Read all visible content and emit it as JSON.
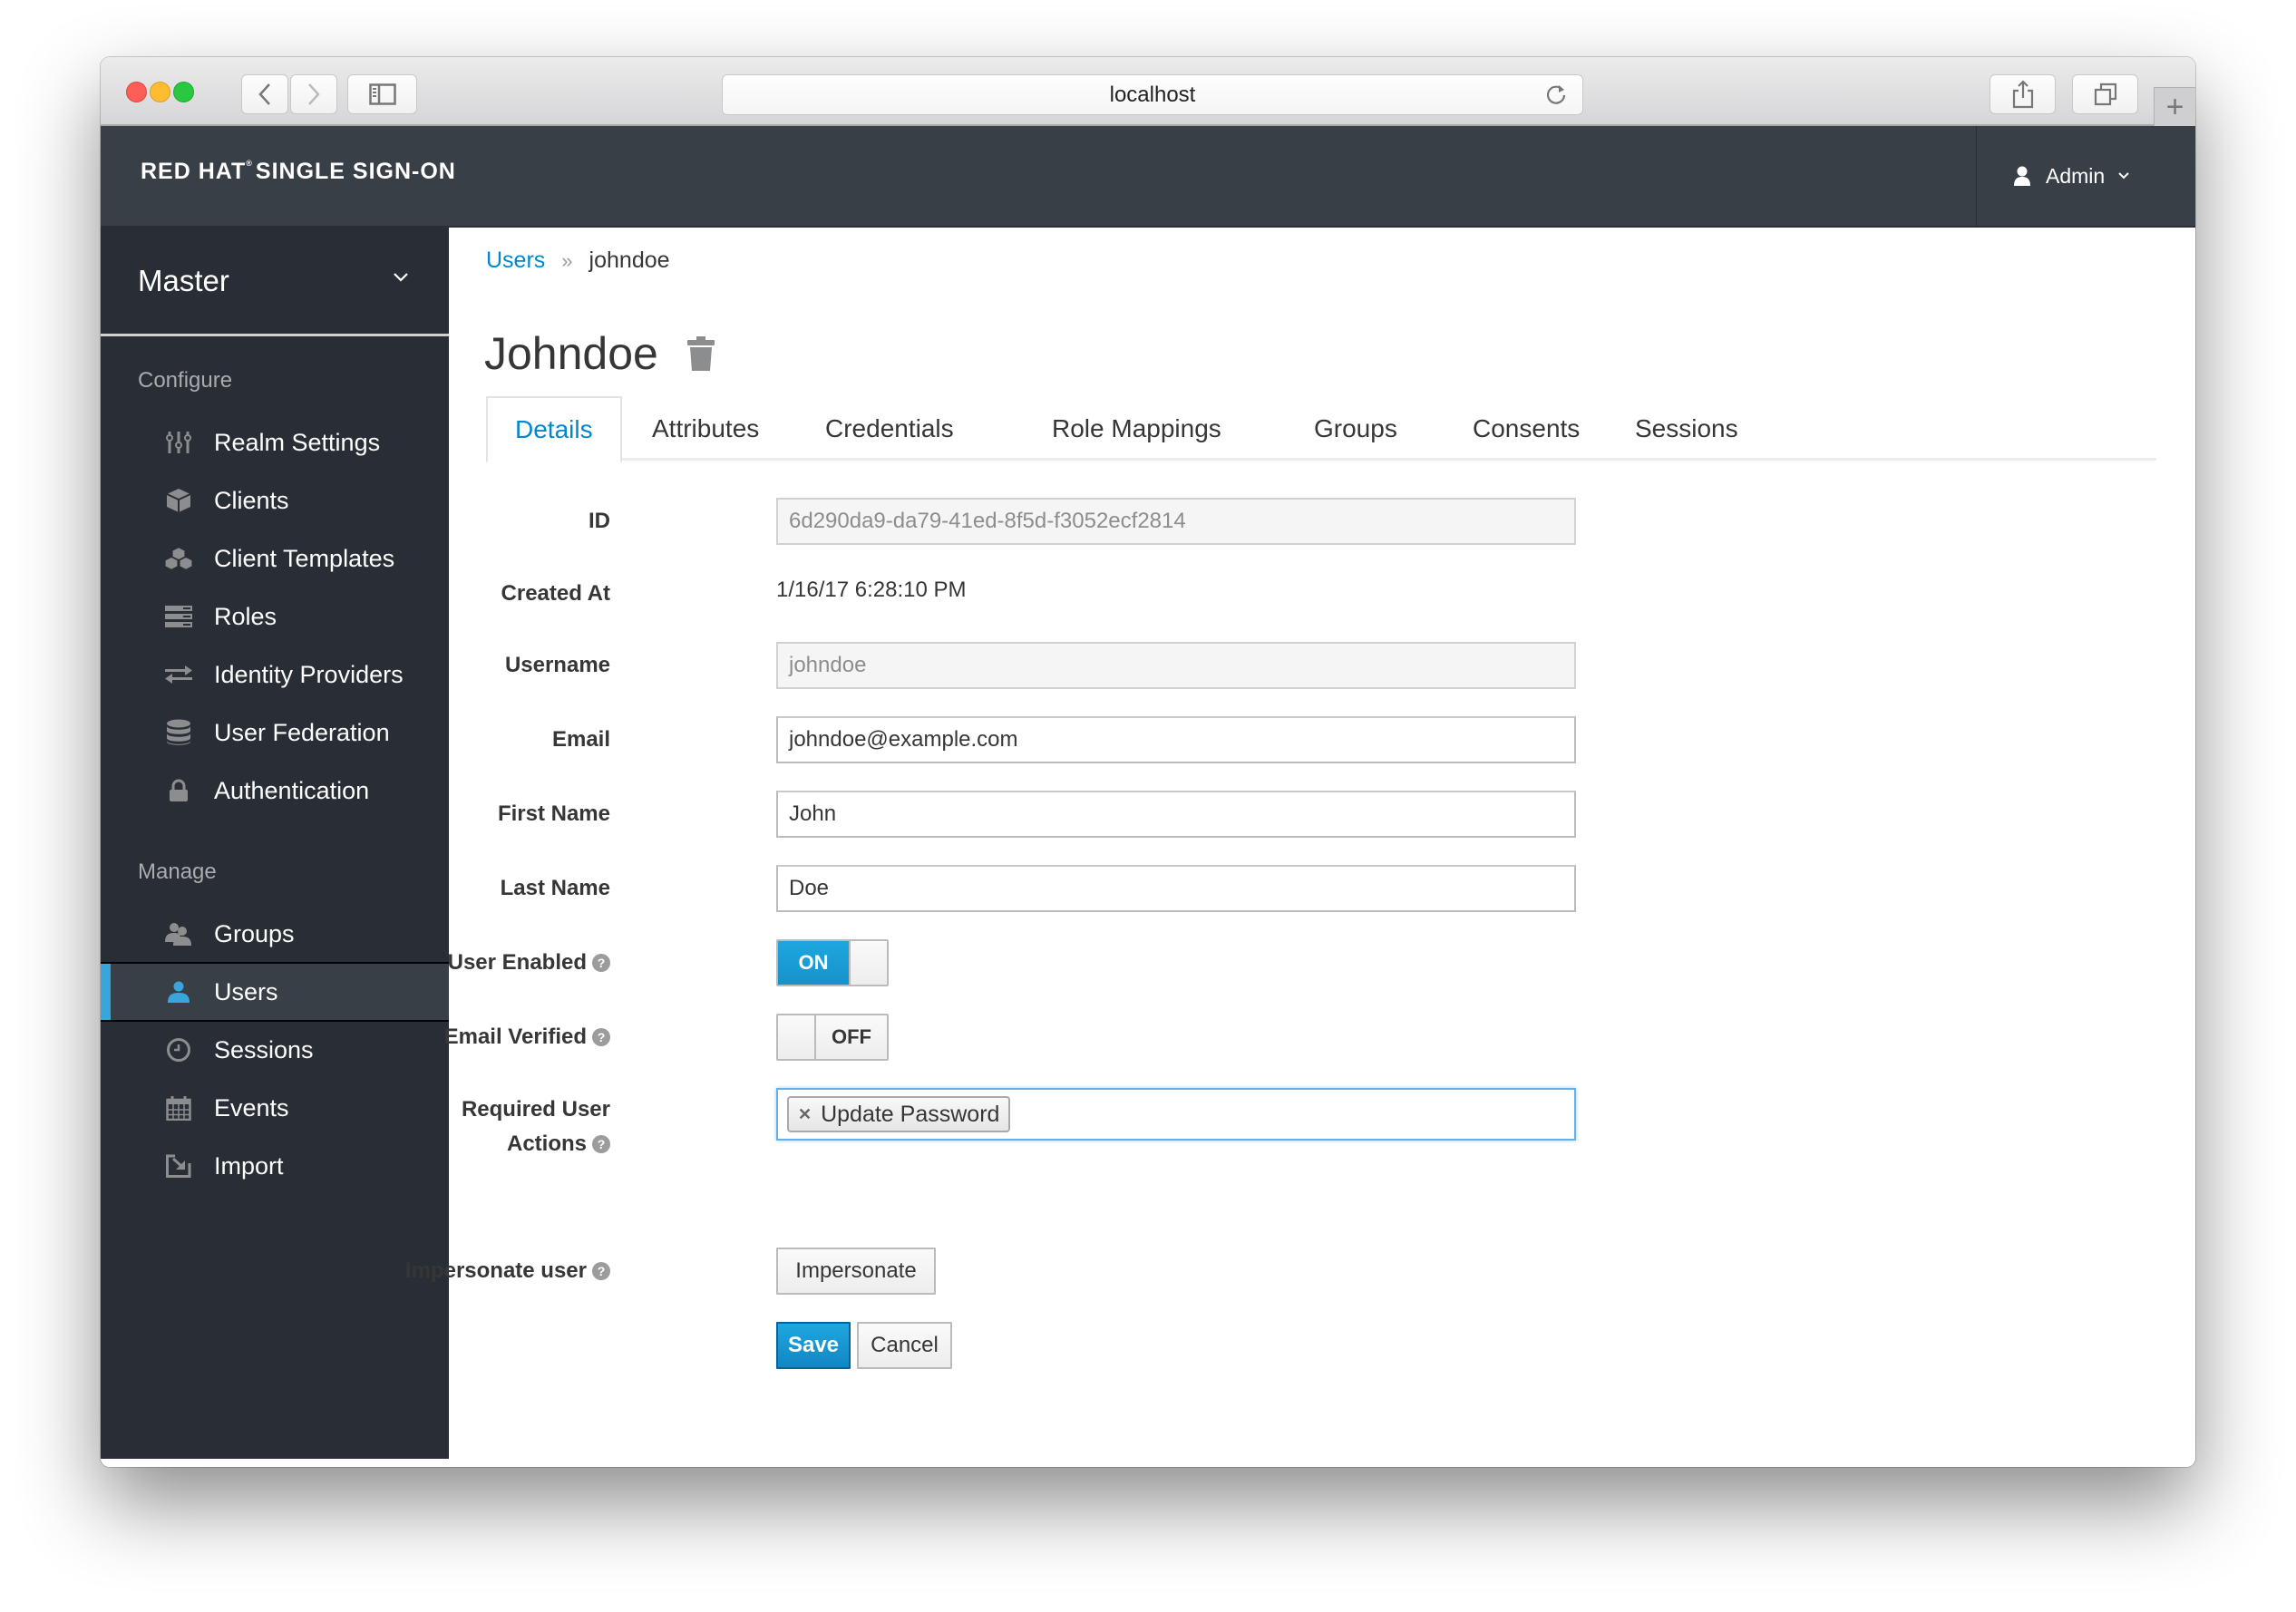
{
  "browser": {
    "url": "localhost"
  },
  "header": {
    "brand_bold": "RED HAT",
    "brand_mark": "®",
    "brand_rest": "SINGLE SIGN-ON",
    "user_label": "Admin"
  },
  "sidebar": {
    "realm": "Master",
    "configure_heading": "Configure",
    "configure_items": [
      {
        "label": "Realm Settings",
        "icon": "sliders-icon"
      },
      {
        "label": "Clients",
        "icon": "cube-icon"
      },
      {
        "label": "Client Templates",
        "icon": "cubes-icon"
      },
      {
        "label": "Roles",
        "icon": "list-icon"
      },
      {
        "label": "Identity Providers",
        "icon": "exchange-icon"
      },
      {
        "label": "User Federation",
        "icon": "database-icon"
      },
      {
        "label": "Authentication",
        "icon": "lock-icon"
      }
    ],
    "manage_heading": "Manage",
    "manage_items": [
      {
        "label": "Groups",
        "icon": "users-icon"
      },
      {
        "label": "Users",
        "icon": "user-icon",
        "active": true
      },
      {
        "label": "Sessions",
        "icon": "clock-icon"
      },
      {
        "label": "Events",
        "icon": "calendar-icon"
      },
      {
        "label": "Import",
        "icon": "import-icon"
      }
    ]
  },
  "breadcrumb": {
    "parent": "Users",
    "separator": "»",
    "current": "johndoe"
  },
  "page": {
    "title": "Johndoe"
  },
  "tabs": [
    {
      "label": "Details",
      "active": true
    },
    {
      "label": "Attributes"
    },
    {
      "label": "Credentials"
    },
    {
      "label": "Role Mappings"
    },
    {
      "label": "Groups"
    },
    {
      "label": "Consents"
    },
    {
      "label": "Sessions"
    }
  ],
  "form": {
    "id": {
      "label": "ID",
      "value": "6d290da9-da79-41ed-8f5d-f3052ecf2814"
    },
    "created_at": {
      "label": "Created At",
      "value": "1/16/17 6:28:10 PM"
    },
    "username": {
      "label": "Username",
      "value": "johndoe"
    },
    "email": {
      "label": "Email",
      "value": "johndoe@example.com"
    },
    "first_name": {
      "label": "First Name",
      "value": "John"
    },
    "last_name": {
      "label": "Last Name",
      "value": "Doe"
    },
    "user_enabled": {
      "label": "User Enabled",
      "state": "ON"
    },
    "email_verified": {
      "label": "Email Verified",
      "state": "OFF"
    },
    "required_actions": {
      "label_line1": "Required User",
      "label_line2": "Actions",
      "chips": [
        "Update Password"
      ]
    },
    "impersonate": {
      "label": "Impersonate user",
      "button": "Impersonate"
    },
    "save_label": "Save",
    "cancel_label": "Cancel",
    "help_glyph": "?"
  },
  "colors": {
    "accent": "#0088ce",
    "header_bg": "#393f47",
    "sidebar_bg": "#292d35",
    "active_bar": "#39a5dc",
    "toggle_on": "#1ea7df"
  }
}
